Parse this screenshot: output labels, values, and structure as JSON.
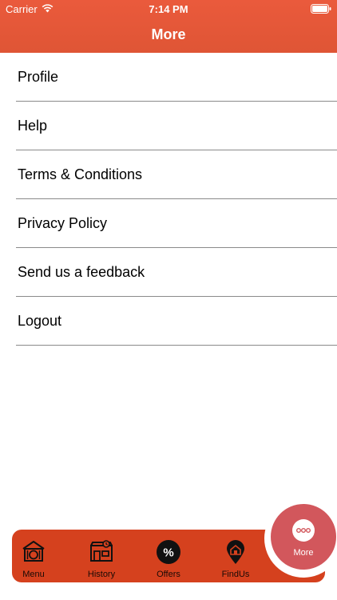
{
  "status_bar": {
    "carrier": "Carrier",
    "time": "7:14 PM"
  },
  "nav": {
    "title": "More"
  },
  "menu": {
    "items": [
      {
        "label": "Profile"
      },
      {
        "label": "Help"
      },
      {
        "label": "Terms & Conditions"
      },
      {
        "label": "Privacy Policy"
      },
      {
        "label": "Send us a feedback"
      },
      {
        "label": "Logout"
      }
    ]
  },
  "tabbar": {
    "tabs": [
      {
        "label": "Menu",
        "icon": "restaurant-plate-icon"
      },
      {
        "label": "History",
        "icon": "shop-clock-icon"
      },
      {
        "label": "Offers",
        "icon": "percent-badge-icon"
      },
      {
        "label": "FindUs",
        "icon": "location-pin-icon"
      }
    ],
    "more": {
      "label": "More",
      "icon": "more-dots-icon"
    }
  },
  "colors": {
    "header": "#e5573a",
    "tabbar": "#d5411e",
    "more_button": "#d2575c",
    "separator": "#8a8a8a"
  }
}
